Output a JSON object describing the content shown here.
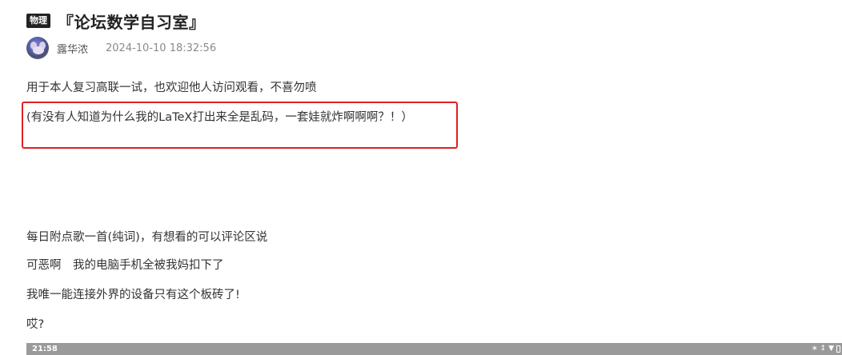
{
  "post": {
    "category_tag": "物理",
    "title": "『论坛数学自习室』",
    "author": "露华浓",
    "timestamp": "2024-10-10 18:32:56"
  },
  "content": {
    "p1": "用于本人复习高联一试，也欢迎他人访问观看，不喜勿喷",
    "p2": "(有没有人知道为什么我的LaTeX打出来全是乱码，一套娃就炸啊啊啊？！）",
    "p3": "每日附点歌一首(纯词)，有想看的可以评论区说",
    "p4": "可恶啊　我的电脑手机全被我妈扣下了",
    "p5": "我唯一能连接外界的设备只有这个板砖了!",
    "p6": "哎?"
  },
  "status_bar": {
    "time": "21:58",
    "icons": [
      "bluetooth-icon",
      "vibrate-icon",
      "wifi-icon",
      "battery-icon"
    ]
  },
  "colors": {
    "highlight": "#e02020",
    "tag_bg": "#222222",
    "status_bar_bg": "#9a9a9a"
  }
}
